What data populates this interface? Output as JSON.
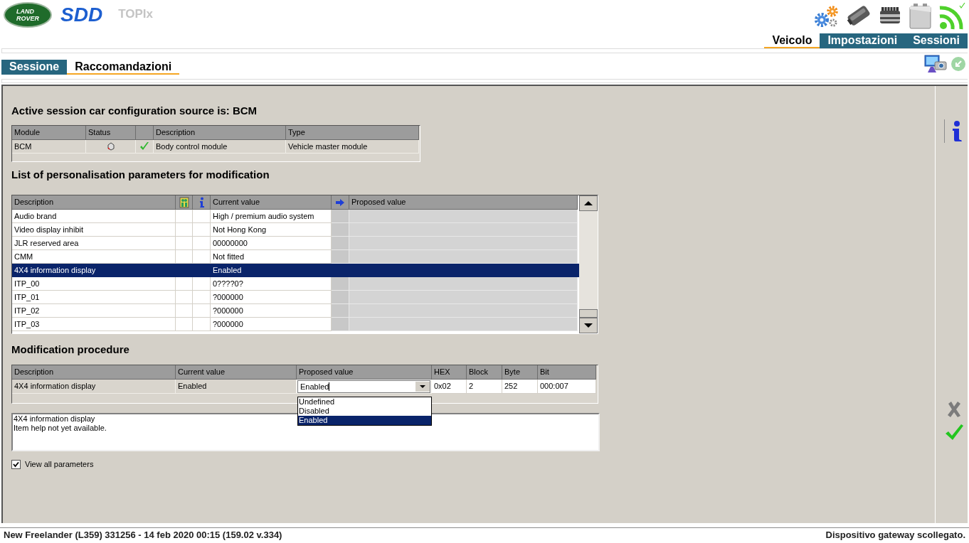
{
  "header": {
    "logo_lines": [
      "LAND",
      "ROVER"
    ],
    "app_name": "SDD",
    "product": "TOPIx"
  },
  "main_tabs": [
    {
      "label": "Veicolo",
      "selected": true
    },
    {
      "label": "Impostazioni",
      "selected": false
    },
    {
      "label": "Sessioni",
      "selected": false
    }
  ],
  "session_tabs": [
    {
      "label": "Sessione",
      "selected": false
    },
    {
      "label": "Raccomandazioni",
      "selected": true
    }
  ],
  "configuration_source": {
    "title": "Active session car configuration source is: BCM",
    "columns": [
      "Module",
      "Status",
      "Description",
      "Type"
    ],
    "rows": [
      {
        "module": "BCM",
        "verified": true,
        "description": "Body control module",
        "type": "Vehicle master module"
      }
    ]
  },
  "parameters": {
    "title": "List of personalisation parameters for modification",
    "columns": [
      "Description",
      "Current value",
      "Proposed value"
    ],
    "rows": [
      {
        "description": "Audio brand",
        "current_value": "High / premium audio system",
        "selected": false
      },
      {
        "description": "Video display inhibit",
        "current_value": "Not Hong Kong",
        "selected": false
      },
      {
        "description": "JLR reserved area",
        "current_value": "00000000",
        "selected": false
      },
      {
        "description": "CMM",
        "current_value": "Not fitted",
        "selected": false
      },
      {
        "description": "4X4 information display",
        "current_value": "Enabled",
        "selected": true
      },
      {
        "description": "ITP_00",
        "current_value": "0????0?",
        "selected": false
      },
      {
        "description": "ITP_01",
        "current_value": "?000000",
        "selected": false
      },
      {
        "description": "ITP_02",
        "current_value": "?000000",
        "selected": false
      },
      {
        "description": "ITP_03",
        "current_value": "?000000",
        "selected": false
      }
    ]
  },
  "modification": {
    "title": "Modification procedure",
    "columns": [
      "Description",
      "Current value",
      "Proposed value",
      "HEX",
      "Block",
      "Byte",
      "Bit"
    ],
    "row": {
      "description": "4X4 information display",
      "current_value": "Enabled",
      "proposed_value": "Enabled",
      "hex": "0x02",
      "block": "2",
      "byte": "252",
      "bit": "000:007"
    },
    "dropdown": {
      "expanded": true,
      "options": [
        {
          "label": "Undefined",
          "selected": false
        },
        {
          "label": "Disabled",
          "selected": false
        },
        {
          "label": "Enabled",
          "selected": true
        }
      ]
    }
  },
  "help": {
    "lines": [
      "4X4 information display",
      "Item help not yet available."
    ]
  },
  "view_all": {
    "label": "View all parameters",
    "checked": true
  },
  "sidebar": {
    "cancel": {
      "disabled": true
    }
  },
  "status_bar": {
    "vehicle": "New Freelander (L359) 331256 - 14 feb 2020 00:15 (159.02 v.334)",
    "gateway": "Dispositivo gateway scollegato."
  }
}
